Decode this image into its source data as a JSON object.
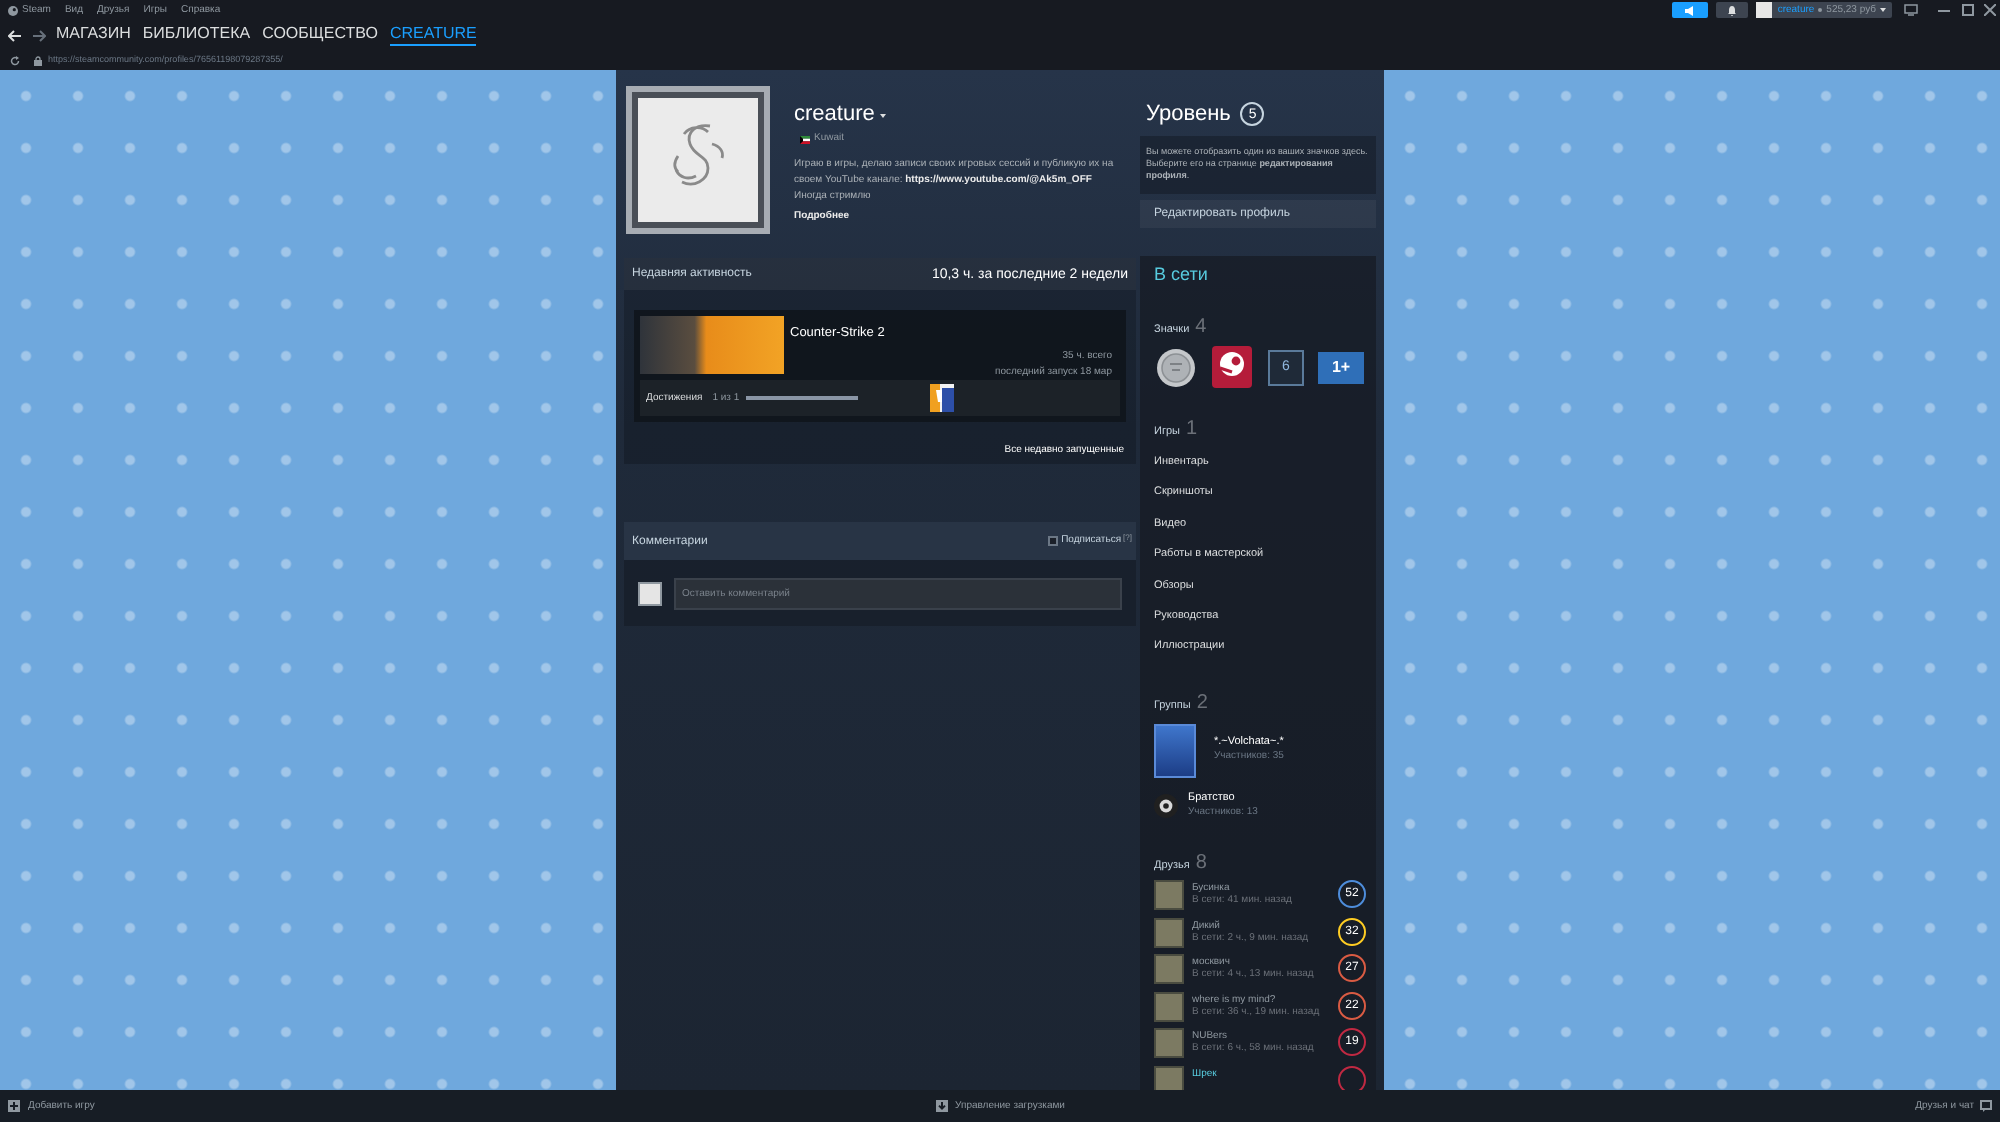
{
  "menu_bar": {
    "items": [
      "Steam",
      "Вид",
      "Друзья",
      "Игры",
      "Справка"
    ]
  },
  "account": {
    "name": "creature",
    "balance": "525,23 руб"
  },
  "nav": {
    "tabs": [
      {
        "label": "МАГАЗИН",
        "selected": false
      },
      {
        "label": "БИБЛИОТЕКА",
        "selected": false
      },
      {
        "label": "СООБЩЕСТВО",
        "selected": false
      },
      {
        "label": "CREATURE",
        "selected": true
      }
    ],
    "url": "https://steamcommunity.com/profiles/76561198079287355/"
  },
  "profile": {
    "name": "creature",
    "country": "Kuwait",
    "summary": "Играю в игры, делаю записи своих игровых сессий и публикую их на своем YouTube канале:",
    "summary_link": "https://www.youtube.com/@Ak5m_OFF",
    "summary_end": "Иногда стримлю",
    "more": "Подробнее"
  },
  "level": {
    "label": "Уровень",
    "value": "5",
    "hint": "Вы можете отобразить один из ваших значков здесь. Выберите его на странице **редактирования профиля**.",
    "edit_button": "Редактировать профиль"
  },
  "activity": {
    "title": "Недавняя активность",
    "hours": "10,3 ч. за последние 2 недели",
    "games": [
      {
        "name": "Counter-Strike 2",
        "total": "35 ч. всего",
        "last_played": "последний запуск 18 мар",
        "achievements_label": "Достижения",
        "achievements_count": "1 из 1",
        "level": 1
      }
    ],
    "all_link": "Все недавно запущенные"
  },
  "comments": {
    "title": "Комментарии",
    "subscribe": {
      "label": "Подписаться",
      "checked": false
    },
    "help": "[?]",
    "placeholder": "Оставить комментарий"
  },
  "sidebar": {
    "status": "В сети",
    "badges": {
      "label": "Значки",
      "count": "4",
      "items": [
        {
          "kind": "coin"
        },
        {
          "kind": "steam"
        },
        {
          "kind": "tile",
          "text": "6"
        },
        {
          "kind": "years",
          "text": "1+"
        }
      ]
    },
    "games": {
      "label": "Игры",
      "count": "1"
    },
    "links": [
      "Инвентарь",
      "Скриншоты",
      "Видео",
      "Работы в мастерской",
      "Обзоры",
      "Руководства",
      "Иллюстрации"
    ],
    "groups": {
      "label": "Группы",
      "count": "2",
      "items": [
        {
          "kind": "banner",
          "name": "*.~Volchata~.*",
          "members": "Участников: 35"
        },
        {
          "kind": "round",
          "name": "Братство",
          "members": "Участников: 13"
        }
      ]
    },
    "friends": {
      "label": "Друзья",
      "count": "8",
      "items": [
        {
          "name": "Бусинка",
          "status": "В сети: 41 мин. назад",
          "level": "52",
          "color": "#4e8ddb",
          "online": false
        },
        {
          "name": "Дикий",
          "status": "В сети: 2 ч., 9 мин. назад",
          "level": "32",
          "color": "#fecc23",
          "online": false
        },
        {
          "name": "москвич",
          "status": "В сети: 4 ч., 13 мин. назад",
          "level": "27",
          "color": "#d95b43",
          "online": false
        },
        {
          "name": "where is my mind?",
          "status": "В сети: 36 ч., 19 мин. назад",
          "level": "22",
          "color": "#d95b43",
          "online": false
        },
        {
          "name": "NUBers",
          "status": "В сети: 6 ч., 58 мин. назад",
          "level": "19",
          "color": "#c02942",
          "online": false
        },
        {
          "name": "Шрек",
          "color": "#c02942",
          "online": true
        }
      ]
    }
  },
  "bottom_bar": {
    "add_game": "Добавить игру",
    "downloads": "Управление загрузками",
    "friends_chat": "Друзья и чат"
  }
}
